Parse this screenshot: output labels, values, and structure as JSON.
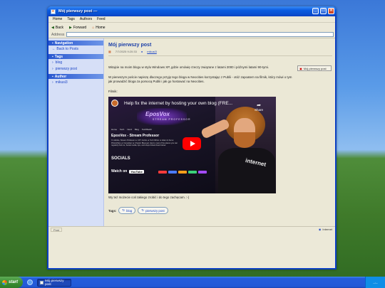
{
  "window": {
    "title": "Mój pierwszy post —",
    "controls": [
      "_",
      "□",
      "×"
    ]
  },
  "menu": [
    "Home",
    "Tags",
    "Authors",
    "Feed"
  ],
  "toolbar": {
    "back": "Back",
    "forward": "Forward",
    "home": "Home",
    "address_label": "Address",
    "address_value": ""
  },
  "sidebar": {
    "navigation_title": "Navigation",
    "back_to_posts": "← Back to Posts",
    "tags_title": "Tags",
    "tags": [
      "blog",
      "pierwszy post"
    ],
    "author_title": "Author",
    "author": "mikusi3"
  },
  "post": {
    "title": "Mój pierwszy post",
    "date": "7/7/2025 9:20:33",
    "author": "mikusi3",
    "para1": "Witajcie na moim blogu w stylu Windows XP, gdzie omówię rzeczy związane z latami 2000 i późnymi latami 90-tymi.",
    "para2": "W pierwszym poście napiszę dlaczego przyję tego bloga w Neocities korzystając z Publii - otóż zapoatem na filmik, który mówi o tym jak prowadzić bloga za pomocą Publii i jak go hostować na Neocities.",
    "image_alt": "Mój pierwszy post",
    "film_label": "Filmik:",
    "outro": "Wy też możecie coś takiego zrobić i do tego zachęcam. :-)",
    "tags_label": "Tags:",
    "tags": [
      "blog",
      "pierwszy post"
    ]
  },
  "video": {
    "title": "Help fix the internet by hosting your own blog (FRE...",
    "share": "Share",
    "logo_main": "EposVox",
    "logo_sub": "STREAM PROFESSOR",
    "nav_items": [
      "Home",
      "Tech",
      "Nerd",
      "Blog",
      "TechBatch"
    ],
    "channel": "EposVox - Stream Professor",
    "bio": "I'm Adobe, Stream Professor ★ CFT Jumbo ★ Tech Writer ★ Adam & Kat ★ PhotoVideo ★ Consultant ★ Chaotic Bisexual. Here's most of the places you can regularly find me, Social media, tips, and shops linked down below.",
    "socials": "SOCIALS",
    "watch_on": "Watch on",
    "youtube": "YouTube",
    "shirt_text": "internet",
    "pill_colors": [
      "#ff3b3b",
      "#4b7bff",
      "#ff9f1a",
      "#3bd17a",
      "#a34bff"
    ]
  },
  "status": {
    "left": "Post",
    "zone": "Internet"
  },
  "taskbar": {
    "start": "start",
    "task": "Mój pierwszy post",
    "clock": "--:--"
  }
}
